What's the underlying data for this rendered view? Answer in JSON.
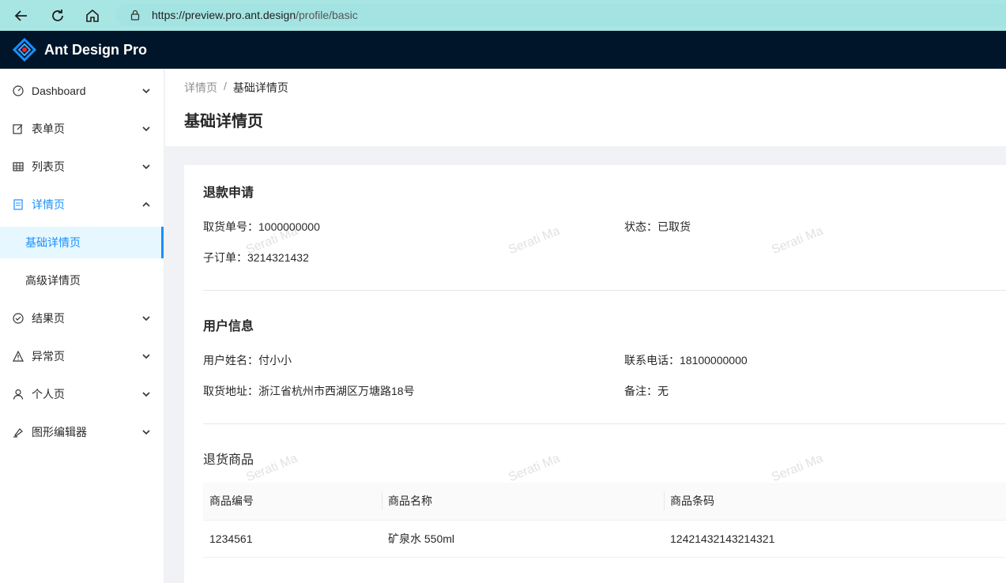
{
  "browser": {
    "url_host": "https://preview.pro.ant.design",
    "url_path": "/profile/basic"
  },
  "app": {
    "title": "Ant Design Pro"
  },
  "sidebar": {
    "items": [
      {
        "label": "Dashboard",
        "icon": "dashboard-icon"
      },
      {
        "label": "表单页",
        "icon": "form-icon"
      },
      {
        "label": "列表页",
        "icon": "table-icon"
      },
      {
        "label": "详情页",
        "icon": "profile-icon",
        "open": true
      },
      {
        "label": "结果页",
        "icon": "check-circle-icon"
      },
      {
        "label": "异常页",
        "icon": "warning-icon"
      },
      {
        "label": "个人页",
        "icon": "user-icon"
      },
      {
        "label": "图形编辑器",
        "icon": "highlight-icon"
      }
    ],
    "sub_items": [
      {
        "label": "基础详情页",
        "active": true
      },
      {
        "label": "高级详情页"
      }
    ]
  },
  "breadcrumb": {
    "parent": "详情页",
    "sep": "/",
    "current": "基础详情页"
  },
  "page_title": "基础详情页",
  "refund": {
    "title": "退款申请",
    "pickup_no": "取货单号：1000000000",
    "status": "状态：已取货",
    "sub_order": "子订单：3214321432"
  },
  "user": {
    "title": "用户信息",
    "name": "用户姓名：付小小",
    "phone": "联系电话：18100000000",
    "address": "取货地址：浙江省杭州市西湖区万塘路18号",
    "remark": "备注：无"
  },
  "goods": {
    "title": "退货商品",
    "headers": [
      "商品编号",
      "商品名称",
      "商品条码"
    ],
    "rows": [
      [
        "1234561",
        "矿泉水 550ml",
        "12421432143214321"
      ]
    ]
  },
  "watermark": "Serati Ma",
  "colors": {
    "primary": "#1890ff",
    "header_bg": "#001529",
    "browser_bar": "#a8e6e3"
  }
}
